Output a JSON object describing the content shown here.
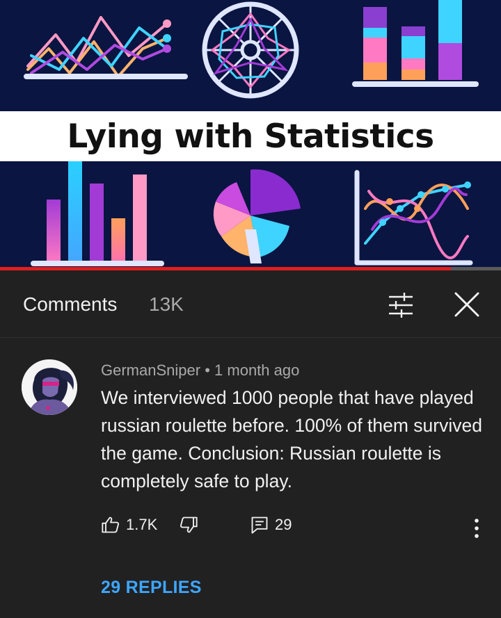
{
  "thumbnail": {
    "title": "Lying with Statistics"
  },
  "player": {
    "progress": 0.9
  },
  "comments_panel": {
    "title": "Comments",
    "count": "13K",
    "filter_icon": "sliders-icon",
    "close_icon": "close-icon"
  },
  "comment": {
    "author": "GermanSniper",
    "separator": "•",
    "time": "1 month ago",
    "text": "We interviewed 1000 people that have played russian roulette before. 100% of them survived the game. Conclusion: Russian roulette is completely safe to play.",
    "likes": "1.7K",
    "reply_count": "29",
    "replies_label": "29 REPLIES"
  },
  "colors": {
    "accent_link": "#3ea6ff",
    "progress_red": "#e01e1e",
    "panel_bg": "#212121",
    "thumb_bg": "#0a1541"
  }
}
